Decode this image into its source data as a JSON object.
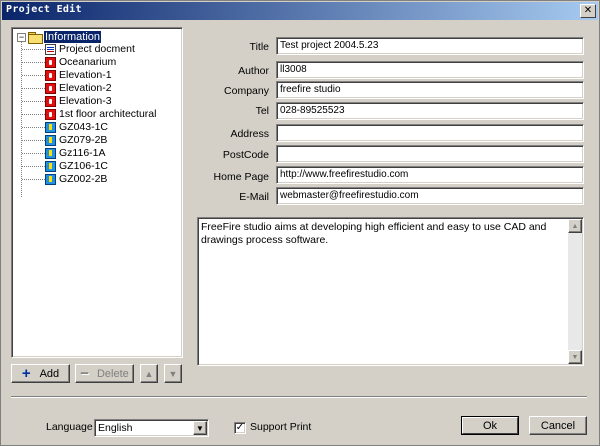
{
  "window": {
    "title": "Project Edit",
    "close_glyph": "✕"
  },
  "tree": {
    "root": {
      "label": "Information",
      "expander": "−",
      "icon": "folder-icon"
    },
    "items": [
      {
        "label": "Project docment",
        "icon": "document-icon"
      },
      {
        "label": "Oceanarium",
        "icon": "red-drawing-icon"
      },
      {
        "label": "Elevation-1",
        "icon": "red-drawing-icon"
      },
      {
        "label": "Elevation-2",
        "icon": "red-drawing-icon"
      },
      {
        "label": "Elevation-3",
        "icon": "red-drawing-icon"
      },
      {
        "label": "1st floor architectural",
        "icon": "red-drawing-icon"
      },
      {
        "label": "GZ043-1C",
        "icon": "blue-drawing-icon"
      },
      {
        "label": "GZ079-2B",
        "icon": "blue-drawing-icon"
      },
      {
        "label": "Gz116-1A",
        "icon": "blue-drawing-icon"
      },
      {
        "label": "GZ106-1C",
        "icon": "blue-drawing-icon"
      },
      {
        "label": "GZ002-2B",
        "icon": "blue-drawing-icon"
      }
    ]
  },
  "buttons": {
    "add": "Add",
    "delete": "Delete",
    "up_glyph": "▲",
    "down_glyph": "▼",
    "ok": "Ok",
    "cancel": "Cancel"
  },
  "form": {
    "fields": [
      {
        "label": "Title",
        "value": "Test project 2004.5.23"
      },
      {
        "label": "Author",
        "value": "ll3008"
      },
      {
        "label": "Company",
        "value": "freefire studio"
      },
      {
        "label": "Tel",
        "value": "028-89525523"
      },
      {
        "label": "Address",
        "value": ""
      },
      {
        "label": "PostCode",
        "value": ""
      },
      {
        "label": "Home Page",
        "value": "http://www.freefirestudio.com"
      },
      {
        "label": "E-Mail",
        "value": "webmaster@freefirestudio.com"
      }
    ],
    "description": "FreeFire studio aims at developing high efficient and easy to use CAD and drawings process software."
  },
  "footer": {
    "language_label": "Language",
    "language_value": "English",
    "support_print_label": "Support Print",
    "support_print_checked": true,
    "check_glyph": "✓"
  }
}
